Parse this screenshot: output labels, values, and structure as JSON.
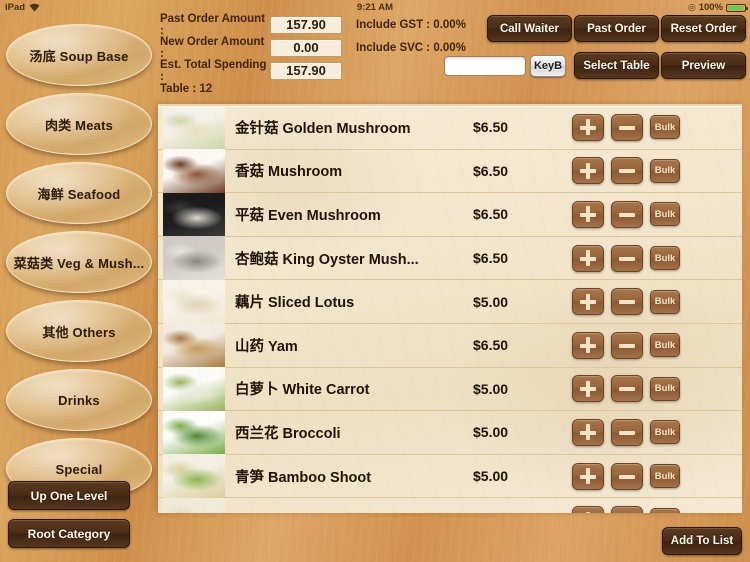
{
  "statusbar": {
    "device": "iPad",
    "wifi_icon": "wifi-icon",
    "time": "9:21 AM",
    "lock_icon": "rotation-lock-icon",
    "battery_percent": "100%",
    "battery_icon": "battery-icon"
  },
  "header": {
    "rows": [
      {
        "label": "Past Order Amount :",
        "value": "157.90",
        "note": "Include GST : 0.00%"
      },
      {
        "label": "New Order Amount :",
        "value": "0.00",
        "note": "Include SVC : 0.00%"
      },
      {
        "label": "Est. Total Spending :",
        "value": "157.90",
        "note": ""
      }
    ],
    "table_label": "Table : 12",
    "search_value": "",
    "search_placeholder": "",
    "keyb_label": "KeyB",
    "buttons": {
      "call_waiter": "Call Waiter",
      "past_order": "Past Order",
      "reset_order": "Reset Order",
      "select_table": "Select Table",
      "preview": "Preview"
    }
  },
  "sidebar": {
    "categories": [
      {
        "label": "汤底 Soup Base"
      },
      {
        "label": "肉类 Meats"
      },
      {
        "label": "海鲜 Seafood"
      },
      {
        "label": "菜菇类 Veg & Mush..."
      },
      {
        "label": "其他 Others"
      },
      {
        "label": "Drinks"
      },
      {
        "label": "Special"
      }
    ],
    "up_one_level": "Up One Level",
    "root_category": "Root Category"
  },
  "menu": {
    "plus_label": "+",
    "minus_label": "-",
    "bulk_label": "Bulk",
    "items": [
      {
        "cn": "金针菇",
        "en": "Golden Mushroom",
        "price": "$6.50",
        "thumb": "golden-mushroom-photo",
        "c1": "#f4f1e6",
        "c2": "#e8e0c4",
        "c3": "#cdd6a8"
      },
      {
        "cn": "香菇",
        "en": "Mushroom",
        "price": "$6.50",
        "thumb": "shiitake-mushroom-photo",
        "c1": "#fbf8f2",
        "c2": "#8d5432",
        "c3": "#6b3a20"
      },
      {
        "cn": "平菇",
        "en": "Even Mushroom",
        "price": "$6.50",
        "thumb": "oyster-mushroom-photo",
        "c1": "#1b1b1b",
        "c2": "#ded9d0",
        "c3": "#3a3a3a"
      },
      {
        "cn": "杏鲍菇",
        "en": "King Oyster Mush...",
        "price": "$6.50",
        "thumb": "king-oyster-photo",
        "c1": "#cfcac4",
        "c2": "#8c8984",
        "c3": "#e4e1dc"
      },
      {
        "cn": "藕片",
        "en": "Sliced Lotus",
        "price": "$5.00",
        "thumb": "sliced-lotus-photo",
        "c1": "#f7f3e8",
        "c2": "#ded3b4",
        "c3": "#efe7d2"
      },
      {
        "cn": "山药",
        "en": "Yam",
        "price": "$6.50",
        "thumb": "yam-photo",
        "c1": "#f2ece0",
        "c2": "#c79a5c",
        "c3": "#a87a40"
      },
      {
        "cn": "白萝卜",
        "en": "White Carrot",
        "price": "$5.00",
        "thumb": "white-carrot-photo",
        "c1": "#fbfbf7",
        "c2": "#eceade",
        "c3": "#96b45c"
      },
      {
        "cn": "西兰花",
        "en": "Broccoli",
        "price": "$5.00",
        "thumb": "broccoli-photo",
        "c1": "#fdfdfa",
        "c2": "#4f8a34",
        "c3": "#76ab4a"
      },
      {
        "cn": "青笋",
        "en": "Bamboo Shoot",
        "price": "$5.00",
        "thumb": "bamboo-shoot-photo",
        "c1": "#f3efe3",
        "c2": "#8bb54c",
        "c3": "#d9cf9a"
      },
      {
        "cn": "",
        "en": "",
        "price": "",
        "thumb": "next-item-photo",
        "c1": "#f0ead9",
        "c2": "#ddd2b3",
        "c3": "#e7dfc6"
      }
    ]
  },
  "footer": {
    "add_to_list": "Add To List"
  },
  "colors": {
    "background": "#d79a55",
    "panel": "#f3e6cd",
    "button_brown": "#4a2d16",
    "action_brown": "#97653c",
    "glyph_cream": "#f3e4c6"
  }
}
